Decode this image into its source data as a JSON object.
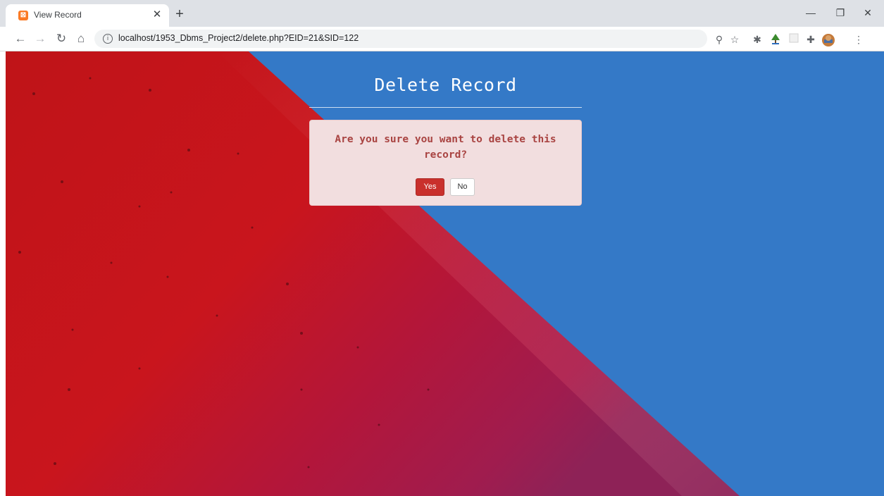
{
  "browser": {
    "tab_title": "View Record",
    "url": "localhost/1953_Dbms_Project2/delete.php?EID=21&SID=122",
    "icons": {
      "favicon": "xampp-favicon-icon",
      "tab_close": "close-icon",
      "new_tab": "plus-icon",
      "minimize": "minimize-icon",
      "restore": "restore-icon",
      "close_window": "close-window-icon",
      "back": "back-arrow-icon",
      "forward": "forward-arrow-icon",
      "reload": "reload-icon",
      "home": "home-icon",
      "site_info": "info-icon",
      "zoom": "zoom-icon",
      "bookmark": "star-icon",
      "extensions": [
        "bug-extension-icon",
        "tree-extension-icon",
        "blank-extension-icon",
        "puzzle-extension-icon"
      ],
      "profile": "avatar-icon",
      "menu": "more-vert-icon"
    }
  },
  "page": {
    "title": "Delete Record",
    "alert_message": "Are you sure you want to delete this record?",
    "yes_label": "Yes",
    "no_label": "No"
  },
  "colors": {
    "background_blue": "#3479c7",
    "background_red": "#c9151d",
    "alert_bg": "#f2dedf",
    "alert_text": "#a94442",
    "danger_button": "#c9302c"
  }
}
